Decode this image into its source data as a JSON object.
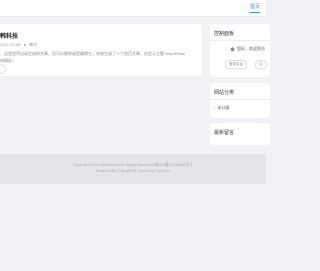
{
  "topbar": {
    "home_label": "首页"
  },
  "post": {
    "title": "韩科技",
    "date": "2021-02-08",
    "author_icon": "user-icon",
    "author": "韩科",
    "excerpt": "，这是程序自动生成的文章，您可以删除或是编辑它，系统生成了一个首页文章，自定义主题 WordPress",
    "excerpt2": "的精彩！",
    "read_more_icon": "ellipsis-icon"
  },
  "control": {
    "title": "控制面板",
    "welcome": "您好，欢迎到访",
    "btn_login": "登录后台",
    "btn_more": "注"
  },
  "categories": {
    "title": "网站分类",
    "items": [
      "未分类"
    ]
  },
  "recent": {
    "title": "最新留言"
  },
  "footer": {
    "line1": "Copyright Your WebSite.Some Rights Reserved.备ICP备11004485号-1",
    "line2": "Powered By Z-BlogPHP Theme by YOYOuo"
  },
  "colors": {
    "accent": "#3a8ee6",
    "bg": "#f0f2f5",
    "footer_bg": "#e3e5e8"
  }
}
